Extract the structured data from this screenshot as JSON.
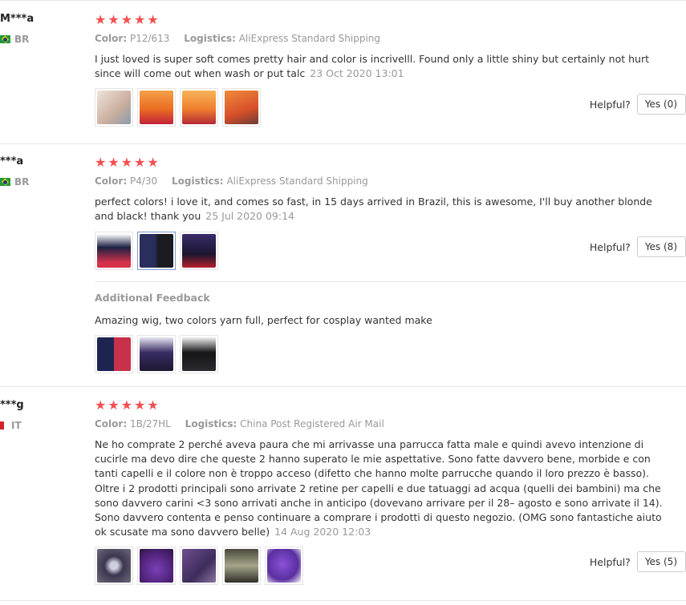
{
  "reviews": [
    {
      "user": "M***a",
      "country": "BR",
      "stars": 5,
      "color_label": "Color:",
      "color_value": "P12/613",
      "logistics_label": "Logistics:",
      "logistics_value": "AliExpress Standard Shipping",
      "text": "I just loved is super soft comes pretty hair and color is incrivelll. Found only a little shiny but certainly not hurt since will come out when wash or put talc",
      "date": "23 Oct 2020 13:01",
      "helpful_label": "Helpful?",
      "yes_label": "Yes (0)",
      "thumbs": [
        "#d9c3b5",
        "#ee7a2a",
        "#f08a36",
        "#e3622a"
      ]
    },
    {
      "user": "***a",
      "country": "BR",
      "stars": 5,
      "color_label": "Color:",
      "color_value": "P4/30",
      "logistics_label": "Logistics:",
      "logistics_value": "AliExpress Standard Shipping",
      "text": "perfect colors! i love it, and comes so fast, in 15 days arrived in Brazil, this is awesome, I'll buy another blonde and black! thank you",
      "date": "25 Jul 2020 09:14",
      "helpful_label": "Helpful?",
      "yes_label": "Yes (8)",
      "thumbs": [
        "#2a2f55",
        "#3c3a66",
        "#2d2550"
      ],
      "additional": {
        "title": "Additional Feedback",
        "text": "Amazing wig, two colors yarn full, perfect for cosplay wanted make",
        "thumbs": [
          "#2b3160",
          "#352a58",
          "#1e1e28"
        ]
      }
    },
    {
      "user": "***g",
      "country": "IT",
      "stars": 5,
      "color_label": "Color:",
      "color_value": "1B/27HL",
      "logistics_label": "Logistics:",
      "logistics_value": "China Post Registered Air Mail",
      "text": "Ne ho comprate 2 perché aveva paura che mi arrivasse una parrucca fatta male e quindi avevo intenzione di cucirle ma devo dire che queste 2 hanno superato le mie aspettative. Sono fatte davvero bene, morbide e con tanti capelli e il colore non è troppo acceso (difetto che hanno molte parrucche quando il loro prezzo è basso). Oltre i 2 prodotti principali sono arrivate 2 retine per capelli e due tatuaggi ad acqua (quelli dei bambini) ma che sono davvero carini <3 sono arrivati anche in anticipo (dovevano arrivare per il 28– agosto e sono arrivate il 14). Sono davvero contenta e penso continuare a comprare i prodotti di questo negozio. (OMG sono fantastiche aiuto ok scusate ma sono davvero belle)",
      "date": "14 Aug 2020 12:03",
      "helpful_label": "Helpful?",
      "yes_label": "Yes (5)",
      "thumbs": [
        "#5a4b6e",
        "#5b2d86",
        "#5d3f7a",
        "#6b6a58",
        "#6a3fb0"
      ]
    }
  ],
  "colors": {
    "star": "#f44f4f",
    "muted": "#999999",
    "text": "#333333",
    "separator": "#e8e8e8"
  },
  "icons": {
    "star": "star-icon",
    "flag_br": "brazil-flag-icon",
    "flag_it": "italy-flag-icon"
  }
}
